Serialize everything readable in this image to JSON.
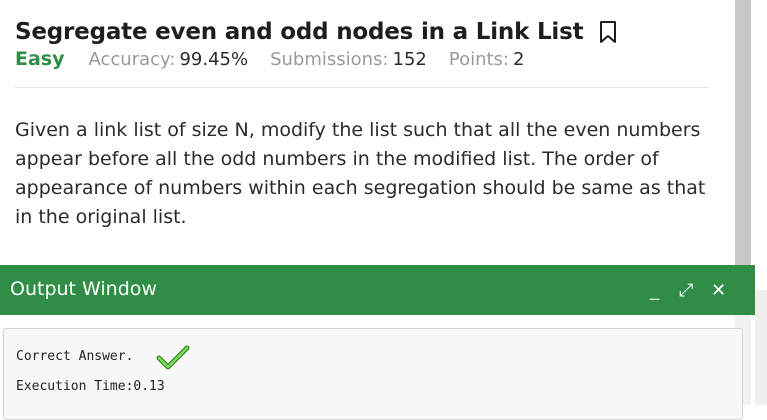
{
  "problem": {
    "title": "Segregate even and odd nodes in a Link List",
    "difficulty": "Easy",
    "accuracy_label": "Accuracy:",
    "accuracy_value": "99.45%",
    "submissions_label": "Submissions:",
    "submissions_value": "152",
    "points_label": "Points:",
    "points_value": "2",
    "description": "Given a link list of size N, modify the list such that all the even numbers appear before all the odd numbers in the modified list. The order of appearance of numbers within each segregation should be same as that in the original list."
  },
  "output_window": {
    "title": "Output Window",
    "controls": {
      "minimize": "_",
      "expand": "⤢",
      "close": "✕"
    },
    "result_text": "Correct Answer.",
    "execution_time": "Execution Time:0.13"
  },
  "colors": {
    "brand_green": "#2f8d46",
    "check_green": "#5cc43a"
  },
  "icons": [
    "bookmark-icon",
    "minimize-icon",
    "expand-icon",
    "close-icon",
    "checkmark-icon"
  ]
}
